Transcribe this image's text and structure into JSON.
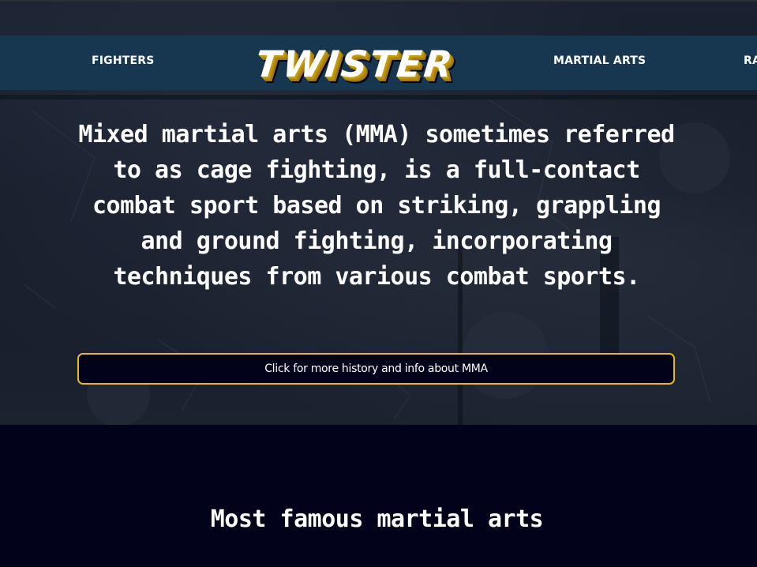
{
  "nav": {
    "fighters_label": "FIGHTERS",
    "logo_text": "TWISTER",
    "martial_arts_label": "MARTIAL ARTS",
    "partial_label": "RA"
  },
  "hero": {
    "intro_text": "Mixed martial arts (MMA) sometimes referred to as cage fighting, is a full-contact combat sport based on striking, grappling and ground fighting, incorporating techniques from various combat sports.",
    "cta_label": "Click for more history and info about MMA"
  },
  "section": {
    "title": "Most famous martial arts"
  },
  "colors": {
    "nav_background": "#173650",
    "page_background": "#02021a",
    "button_border": "#e8b820",
    "logo_shadow": "#c49a0e"
  }
}
